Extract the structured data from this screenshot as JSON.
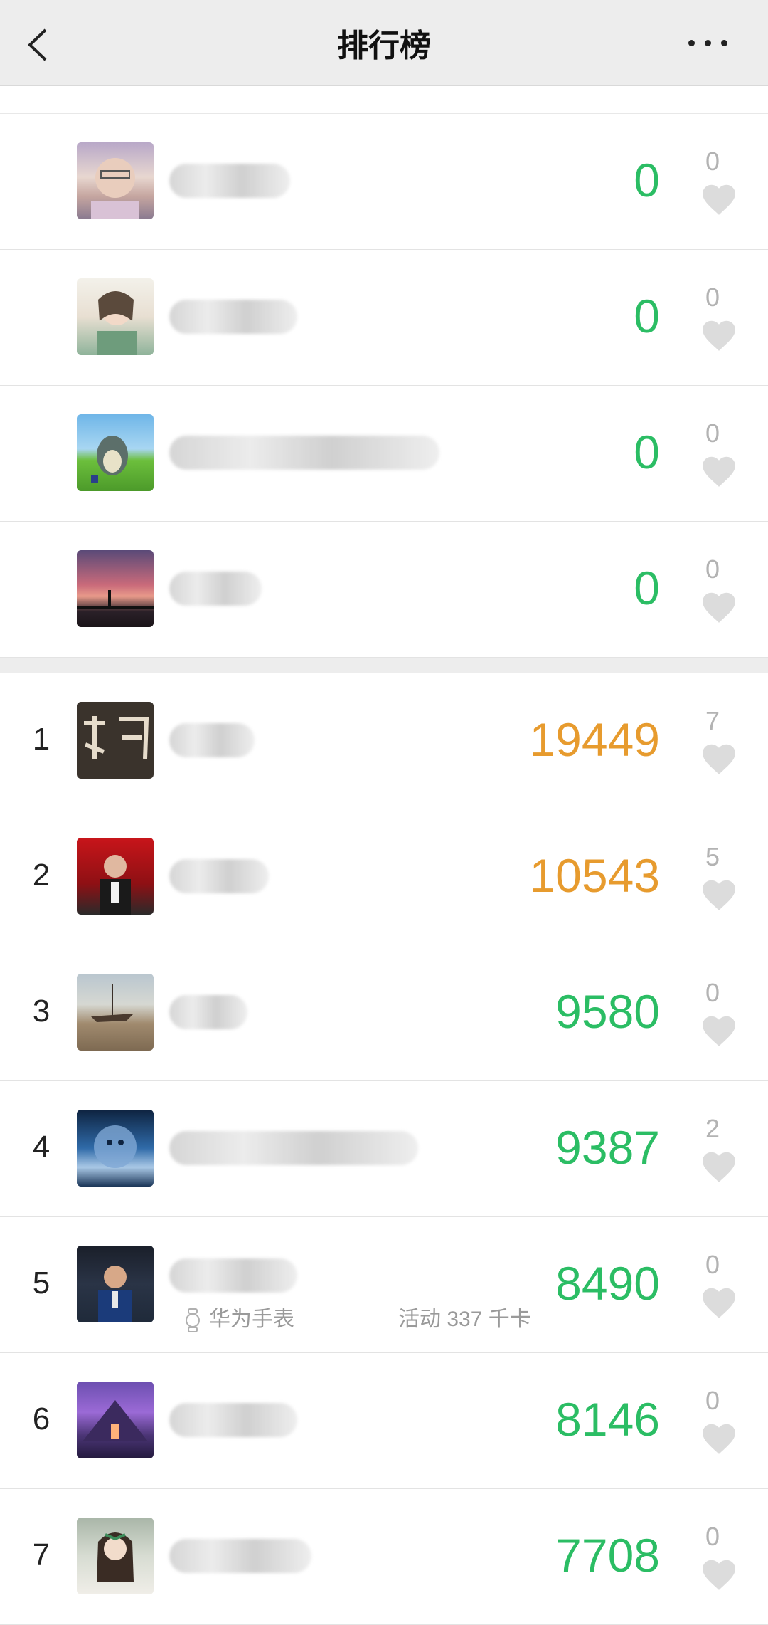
{
  "header": {
    "title": "排行榜"
  },
  "my_group": [
    {
      "steps": "0",
      "likes": "0"
    },
    {
      "steps": "0",
      "likes": "0"
    },
    {
      "steps": "0",
      "likes": "0"
    },
    {
      "steps": "0",
      "likes": "0"
    }
  ],
  "ranking": [
    {
      "rank": "1",
      "steps": "19449",
      "likes": "7"
    },
    {
      "rank": "2",
      "steps": "10543",
      "likes": "5"
    },
    {
      "rank": "3",
      "steps": "9580",
      "likes": "0"
    },
    {
      "rank": "4",
      "steps": "9387",
      "likes": "2"
    },
    {
      "rank": "5",
      "steps": "8490",
      "likes": "0",
      "device": "华为手表",
      "activity": "活动 337 千卡"
    },
    {
      "rank": "6",
      "steps": "8146",
      "likes": "0"
    },
    {
      "rank": "7",
      "steps": "7708",
      "likes": "0"
    }
  ],
  "colors": {
    "green": "#2bbd64",
    "orange": "#e79b2e"
  }
}
